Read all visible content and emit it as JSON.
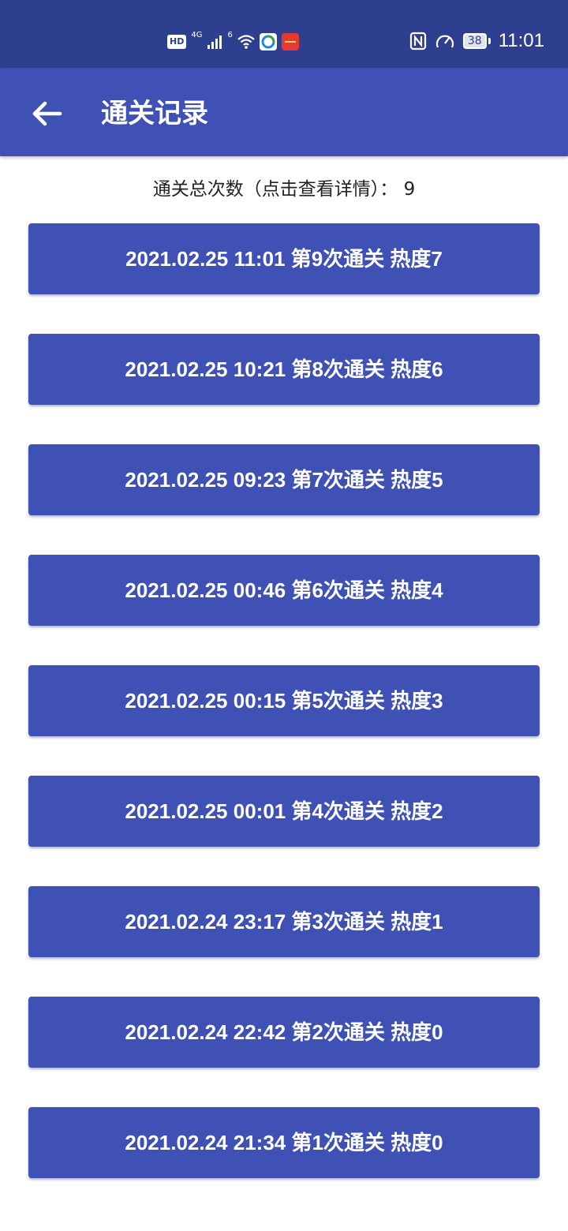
{
  "status_bar": {
    "hd_label": "HD",
    "network_label": "4G",
    "wifi_label": "6",
    "battery_level": "38",
    "time": "11:01",
    "background": "#2f3f8f"
  },
  "app_bar": {
    "back_icon": "arrow-left-icon",
    "title": "通关记录",
    "background": "#3f51b5"
  },
  "summary": {
    "text": "通关总次数（点击查看详情）： 9"
  },
  "records": [
    {
      "label": "2021.02.25 11:01 第9次通关 热度7"
    },
    {
      "label": "2021.02.25 10:21 第8次通关 热度6"
    },
    {
      "label": "2021.02.25 09:23 第7次通关 热度5"
    },
    {
      "label": "2021.02.25 00:46 第6次通关 热度4"
    },
    {
      "label": "2021.02.25 00:15 第5次通关 热度3"
    },
    {
      "label": "2021.02.25 00:01 第4次通关 热度2"
    },
    {
      "label": "2021.02.24 23:17 第3次通关 热度1"
    },
    {
      "label": "2021.02.24 22:42 第2次通关 热度0"
    },
    {
      "label": "2021.02.24 21:34 第1次通关 热度0"
    }
  ],
  "colors": {
    "accent": "#3f51b5",
    "text_on_accent": "#ffffff"
  }
}
